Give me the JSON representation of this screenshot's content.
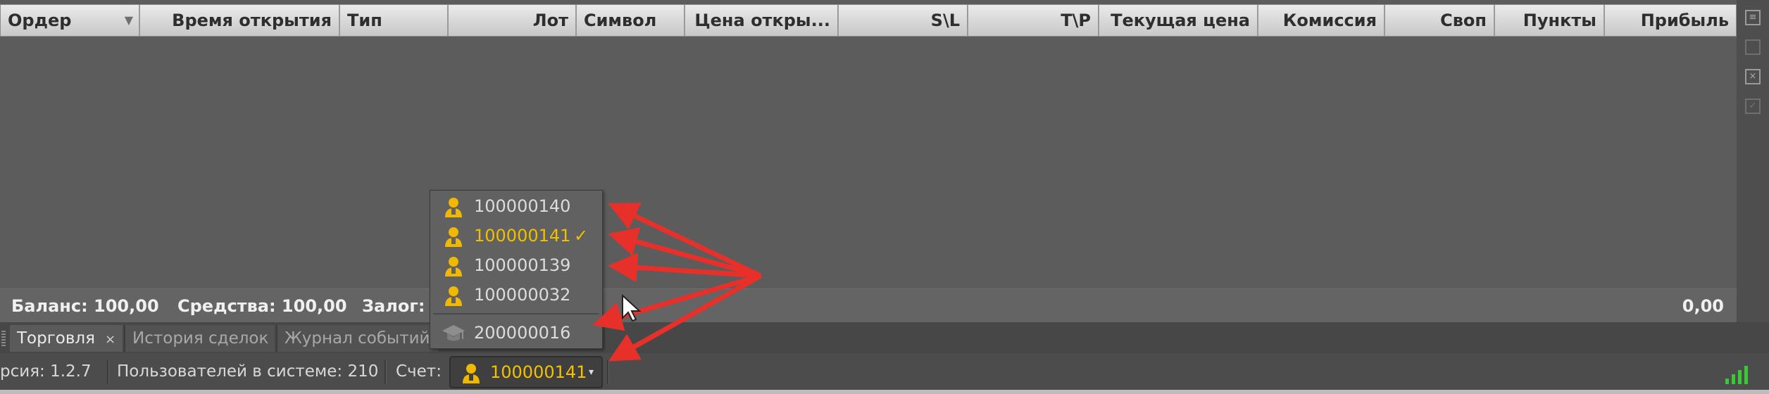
{
  "columns": [
    {
      "label": "Ордер",
      "sortable": true
    },
    {
      "label": "Время открытия"
    },
    {
      "label": "Тип"
    },
    {
      "label": "Лот"
    },
    {
      "label": "Символ"
    },
    {
      "label": "Цена откры..."
    },
    {
      "label": "S\\L"
    },
    {
      "label": "T\\P"
    },
    {
      "label": "Текущая цена"
    },
    {
      "label": "Комиссия"
    },
    {
      "label": "Своп"
    },
    {
      "label": "Пункты"
    },
    {
      "label": "Прибыль"
    }
  ],
  "summary": {
    "balance": "Баланс: 100,00",
    "equity": "Средства: 100,00",
    "margin": "Залог:",
    "profit": "0,00"
  },
  "tabs": [
    {
      "label": "Торговля",
      "active": true,
      "close": "×"
    },
    {
      "label": "История сделок"
    },
    {
      "label": "Журнал событий"
    }
  ],
  "status": {
    "version": "рсия:  1.2.7",
    "users": "Пользователей в системе:  210",
    "account_label": "Счет:",
    "account_value": "100000141",
    "caret": "▾"
  },
  "dropdown": {
    "items": [
      {
        "number": "100000140",
        "icon": "user-icon"
      },
      {
        "number": "100000141",
        "icon": "user-icon",
        "selected": true,
        "check": "✓"
      },
      {
        "number": "100000139",
        "icon": "user-icon"
      },
      {
        "number": "100000032",
        "icon": "user-icon"
      },
      {
        "number": "200000016",
        "icon": "graduation-cap-icon"
      }
    ]
  },
  "colors": {
    "accent": "#f0c000",
    "annotation": "#e8302a",
    "signal": "#38c838"
  }
}
